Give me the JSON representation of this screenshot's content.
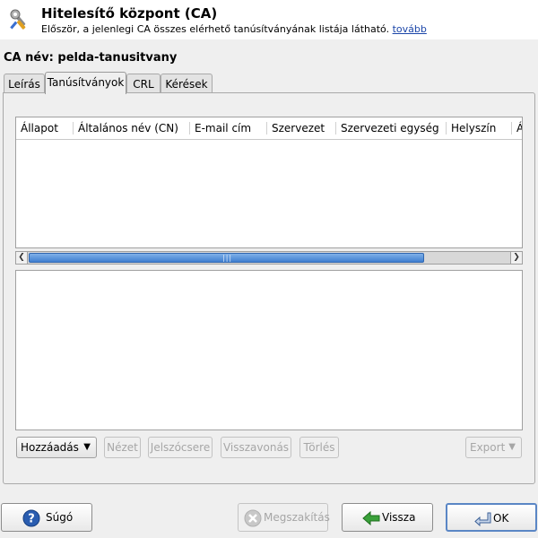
{
  "header": {
    "title": "Hitelesítő központ (CA)",
    "subtitle": "Először, a jelenlegi CA összes elérhető tanúsítványának listája látható.",
    "more_link": "tovább",
    "icon": "wrench-screwdriver-icon"
  },
  "ca_name_label": "CA név: pelda-tanusitvany",
  "tabs": [
    {
      "label": "Leírás",
      "active": false
    },
    {
      "label": "Tanúsítványok",
      "active": true
    },
    {
      "label": "CRL",
      "active": false
    },
    {
      "label": "Kérések",
      "active": false
    }
  ],
  "table": {
    "columns": [
      "Állapot",
      "Általános név (CN)",
      "E-mail cím",
      "Szervezet",
      "Szervezeti egység",
      "Helyszín",
      "Á"
    ],
    "rows": []
  },
  "actions": {
    "add": "Hozzáadás",
    "view": "Nézet",
    "password": "Jelszócsere",
    "revoke": "Visszavonás",
    "delete": "Törlés",
    "export": "Export"
  },
  "footer": {
    "help": "Súgó",
    "cancel": "Megszakítás",
    "back": "Vissza",
    "ok": "OK"
  },
  "colors": {
    "link": "#1a45a8",
    "scroll_thumb": "#3f7fd0",
    "help_icon": "#2a5db0",
    "back_icon": "#3aa13a"
  }
}
